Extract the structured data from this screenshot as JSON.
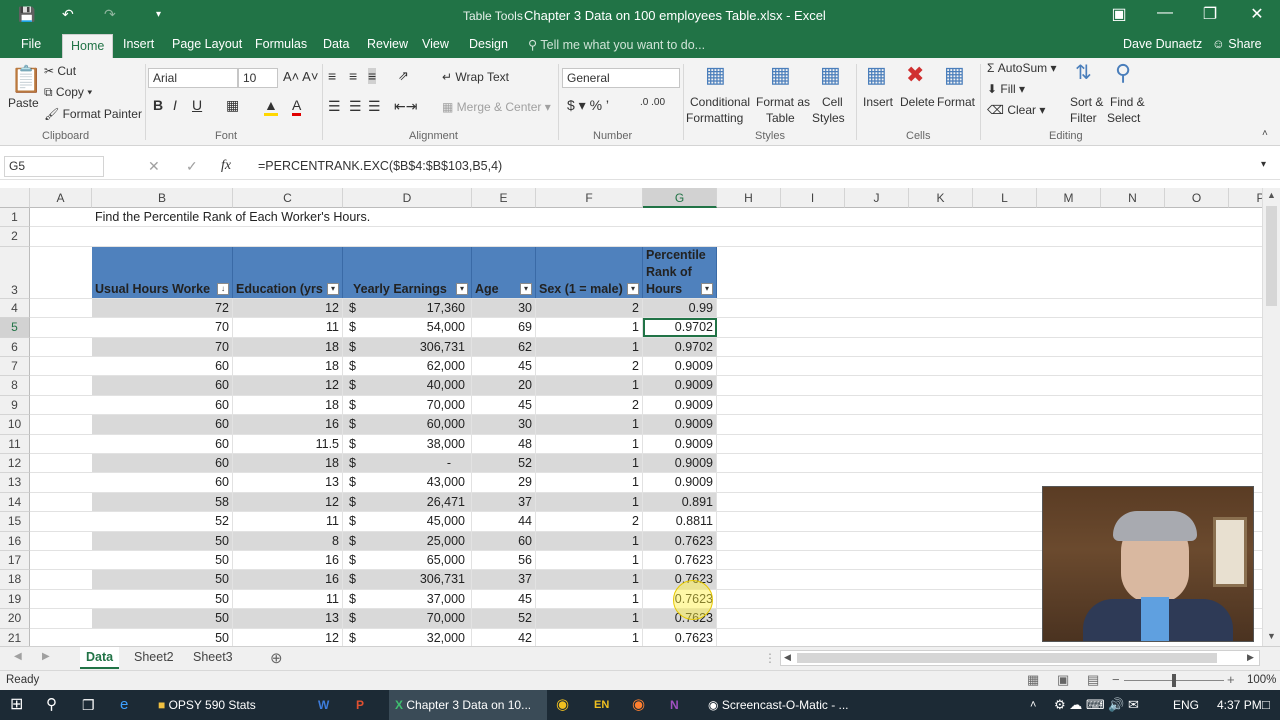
{
  "window": {
    "tools_label": "Table Tools",
    "title": "Chapter 3 Data on 100 employees Table.xlsx - Excel"
  },
  "tabs": [
    "File",
    "Home",
    "Insert",
    "Page Layout",
    "Formulas",
    "Data",
    "Review",
    "View",
    "Design"
  ],
  "tell_me": "Tell me what you want to do...",
  "user": "Dave Dunaetz",
  "share": "Share",
  "ribbon": {
    "clipboard": {
      "paste": "Paste",
      "cut": "Cut",
      "copy": "Copy",
      "format_painter": "Format Painter",
      "label": "Clipboard"
    },
    "font": {
      "name": "Arial",
      "size": "10",
      "label": "Font"
    },
    "alignment": {
      "wrap_text": "Wrap Text",
      "merge_center": "Merge & Center",
      "label": "Alignment"
    },
    "number": {
      "format": "General",
      "label": "Number"
    },
    "styles": {
      "conditional": "Conditional",
      "formatting": "Formatting",
      "format_as": "Format as",
      "table": "Table",
      "cell": "Cell",
      "styles_btn": "Styles",
      "label": "Styles"
    },
    "cells": {
      "insert": "Insert",
      "delete": "Delete",
      "format": "Format",
      "label": "Cells"
    },
    "editing": {
      "autosum": "AutoSum",
      "fill": "Fill",
      "clear": "Clear",
      "sort": "Sort &",
      "filter": "Filter",
      "find": "Find &",
      "select": "Select",
      "label": "Editing"
    }
  },
  "formula_bar": {
    "name_box": "G5",
    "fx": "fx",
    "formula": "=PERCENTRANK.EXC($B$4:$B$103,B5,4)"
  },
  "columns": [
    "A",
    "B",
    "C",
    "D",
    "E",
    "F",
    "G",
    "H",
    "I",
    "J",
    "K",
    "L",
    "M",
    "N",
    "O",
    "P"
  ],
  "row_numbers": [
    "1",
    "2",
    "3",
    "4",
    "5",
    "6",
    "7",
    "8",
    "9",
    "10",
    "11",
    "12",
    "13",
    "14",
    "15",
    "16",
    "17",
    "18",
    "19",
    "20",
    "21"
  ],
  "sheet": {
    "title_text": "Find the Percentile Rank of Each Worker's Hours.",
    "headers": [
      "Usual Hours Worke",
      "Education (yrs",
      "Yearly Earnings",
      "Age",
      "Sex (1 = male)",
      "Percentile",
      "Rank of",
      "Hours"
    ],
    "rows": [
      [
        "72",
        "12",
        "$",
        "17,360",
        "30",
        "2",
        "0.99"
      ],
      [
        "70",
        "11",
        "$",
        "54,000",
        "69",
        "1",
        "0.9702"
      ],
      [
        "70",
        "18",
        "$",
        "306,731",
        "62",
        "1",
        "0.9702"
      ],
      [
        "60",
        "18",
        "$",
        "62,000",
        "45",
        "2",
        "0.9009"
      ],
      [
        "60",
        "12",
        "$",
        "40,000",
        "20",
        "1",
        "0.9009"
      ],
      [
        "60",
        "18",
        "$",
        "70,000",
        "45",
        "2",
        "0.9009"
      ],
      [
        "60",
        "16",
        "$",
        "60,000",
        "30",
        "1",
        "0.9009"
      ],
      [
        "60",
        "11.5",
        "$",
        "38,000",
        "48",
        "1",
        "0.9009"
      ],
      [
        "60",
        "18",
        "$",
        "-",
        "52",
        "1",
        "0.9009"
      ],
      [
        "60",
        "13",
        "$",
        "43,000",
        "29",
        "1",
        "0.9009"
      ],
      [
        "58",
        "12",
        "$",
        "26,471",
        "37",
        "1",
        "0.891"
      ],
      [
        "52",
        "11",
        "$",
        "45,000",
        "44",
        "2",
        "0.8811"
      ],
      [
        "50",
        "8",
        "$",
        "25,000",
        "60",
        "1",
        "0.7623"
      ],
      [
        "50",
        "16",
        "$",
        "65,000",
        "56",
        "1",
        "0.7623"
      ],
      [
        "50",
        "16",
        "$",
        "306,731",
        "37",
        "1",
        "0.7623"
      ],
      [
        "50",
        "11",
        "$",
        "37,000",
        "45",
        "1",
        "0.7623"
      ],
      [
        "50",
        "13",
        "$",
        "70,000",
        "52",
        "1",
        "0.7623"
      ],
      [
        "50",
        "12",
        "$",
        "32,000",
        "42",
        "1",
        "0.7623"
      ]
    ]
  },
  "sheet_tabs": [
    "Data",
    "Sheet2",
    "Sheet3"
  ],
  "status": {
    "ready": "Ready",
    "zoom": "100%"
  },
  "taskbar": {
    "apps": [
      "OPSY 590 Stats",
      "Chapter 3 Data on 10...",
      "Screencast-O-Matic - ..."
    ],
    "lang": "ENG",
    "time": "4:37 PM"
  }
}
